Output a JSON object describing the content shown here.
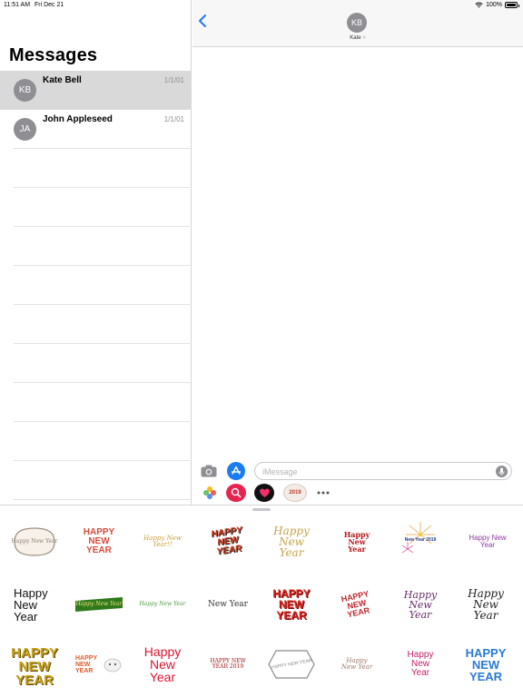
{
  "status_bar": {
    "time": "11:51 AM",
    "date": "Fri Dec 21",
    "battery": "100%"
  },
  "sidebar": {
    "title": "Messages",
    "conversations": [
      {
        "initials": "KB",
        "name": "Kate Bell",
        "date": "1/1/01",
        "selected": true
      },
      {
        "initials": "JA",
        "name": "John Appleseed",
        "date": "1/1/01",
        "selected": false
      }
    ]
  },
  "conversation": {
    "contact_initials": "KB",
    "contact_name": "Kate",
    "contact_chevron": ">",
    "input_placeholder": "iMessage"
  },
  "app_strip": {
    "sticker_pack_label": "2019"
  },
  "stickers": [
    {
      "text": "Happy New Year",
      "color": "#8a7f6e"
    },
    {
      "text": "HAPPY NEW YEAR",
      "color": "#d94a3a"
    },
    {
      "text": "Happy New Year!!",
      "color": "#c9a23a"
    },
    {
      "text": "HAPPY NEW YEAR",
      "color": "#d13b1c"
    },
    {
      "text": "Happy New Year",
      "color": "#c7a446"
    },
    {
      "text": "Happy New Year",
      "color": "#b5171b"
    },
    {
      "text": "New Year 2019",
      "color": "#e6a33a"
    },
    {
      "text": "Happy New Year",
      "color": "#8c3c9e"
    },
    {
      "text": "Happy New Year",
      "color": "#111111"
    },
    {
      "text": "Happy New Year",
      "color": "#2f7a1d"
    },
    {
      "text": "Happy New Year",
      "color": "#4a9a3a"
    },
    {
      "text": "New Year",
      "color": "#333333"
    },
    {
      "text": "HAPPY NEW YEAR",
      "color": "#d6231a"
    },
    {
      "text": "HAPPY NEW YEAR",
      "color": "#c2252a"
    },
    {
      "text": "Happy New Year",
      "color": "#6b2a6b"
    },
    {
      "text": "Happy New Year",
      "color": "#222222"
    },
    {
      "text": "HAPPY NEW YEAR",
      "color": "#c9a21a"
    },
    {
      "text": "HAPPY NEW YEAR",
      "color": "#e05a2a"
    },
    {
      "text": "Happy New Year",
      "color": "#e0122f"
    },
    {
      "text": "HAPPY NEW YEAR 2019",
      "color": "#a31515"
    },
    {
      "text": "HAPPY NEW YEAR",
      "color": "#8a8a8a"
    },
    {
      "text": "Happy New Year",
      "color": "#a07a6a"
    },
    {
      "text": "Happy New Year",
      "color": "#c21f6a"
    },
    {
      "text": "HAPPY NEW YEAR",
      "color": "#2a7ad6"
    }
  ],
  "colors": {
    "accent": "#1a7cf3",
    "selected_row": "#d9d9d9",
    "avatar_gray": "#8e8e93"
  }
}
